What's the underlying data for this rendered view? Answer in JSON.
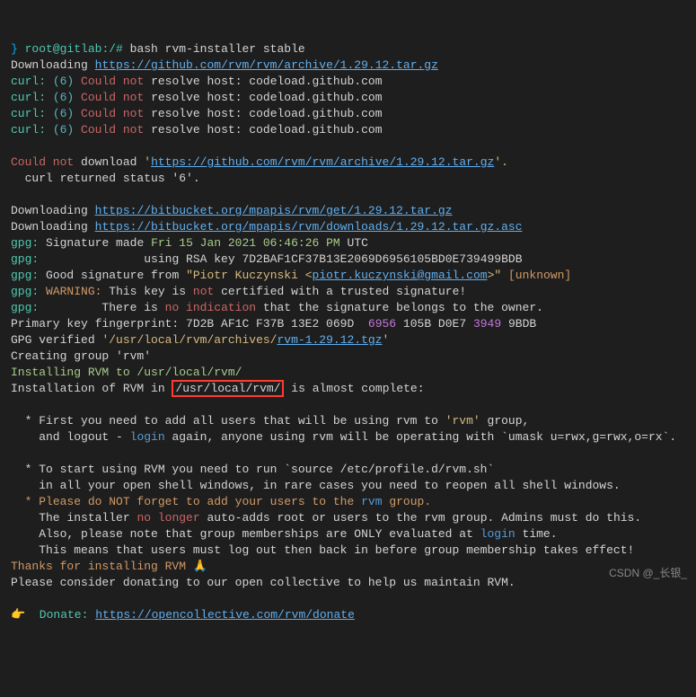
{
  "prompt": {
    "sym": "}",
    "userhost": "root@gitlab:/#",
    "cmd": "bash rvm-installer stable"
  },
  "dl1": {
    "label": "Downloading",
    "url": "https://github.com/rvm/rvm/archive/1.29.12.tar.gz"
  },
  "curlLines": [
    {
      "a": "curl:",
      "b": "(6)",
      "c": "Could not",
      "d": "resolve host: codeload.github.com"
    },
    {
      "a": "curl:",
      "b": "(6)",
      "c": "Could not",
      "d": "resolve host: codeload.github.com"
    },
    {
      "a": "curl:",
      "b": "(6)",
      "c": "Could not",
      "d": "resolve host: codeload.github.com"
    },
    {
      "a": "curl:",
      "b": "(6)",
      "c": "Could not",
      "d": "resolve host: codeload.github.com"
    }
  ],
  "err": {
    "could": "Could not",
    "downloadW": "download",
    "q1": "'",
    "url": "https://github.com/rvm/rvm/archive/1.29.12.tar.gz",
    "q2": "'.",
    "ret": "  curl returned status '6'."
  },
  "dl2": {
    "label": "Downloading",
    "url": "https://bitbucket.org/mpapis/rvm/get/1.29.12.tar.gz"
  },
  "dl3": {
    "label": "Downloading",
    "url": "https://bitbucket.org/mpapis/rvm/downloads/1.29.12.tar.gz.asc"
  },
  "gpg": {
    "sig1a": "gpg:",
    "sig1b": "Signature made",
    "sig1c": "Fri 15 Jan 2021 06:46:26 PM",
    "sig1d": "UTC",
    "sig2a": "gpg:",
    "sig2b": "               using RSA key 7D2BAF1CF37B13E2069D6956105BD0E739499BDB",
    "sig3a": "gpg:",
    "sig3b": "Good signature from",
    "sig3c": "\"Piotr Kuczynski <",
    "sig3email": "piotr.kuczynski@gmail.com",
    "sig3d": ">\"",
    "sig3e": "[unknown]",
    "warn1a": "gpg:",
    "warn1b": "WARNING:",
    "warn1c": "This key is",
    "warn1d": "not",
    "warn1e": "certified with a trusted signature!",
    "warn2a": "gpg:",
    "warn2b": "         There is",
    "warn2c": "no indication",
    "warn2d": "that the signature belongs to the owner.",
    "fp1": "Primary key fingerprint: 7D2B AF1C F37B 13E2 069D ",
    "fp2": "6956",
    "fp3": "105B D0E7",
    "fp4": "3949",
    "fp5": "9BDB",
    "ver1": "GPG verified",
    "ver2": "'/usr/local/rvm/archives/",
    "ver3": "rvm-1.29.12.tgz",
    "ver4": "'"
  },
  "creating": "Creating group 'rvm'",
  "installing": "Installing RVM to /usr/local/rvm/",
  "instOf": "Installation of RVM in",
  "instPath": "/usr/local/rvm/",
  "instRest": "is almost complete:",
  "bullet1a": "  * First you need to add all users that will be using rvm to",
  "bullet1b": "'rvm'",
  "bullet1c": "group,",
  "bullet1d": "    and logout -",
  "bullet1e": "login",
  "bullet1f": "again, anyone using rvm will be operating with `umask u=rwx,g=rwx,o=rx`.",
  "bullet2a": "  * To start using RVM you need to run `source /etc/profile.d/rvm.sh`",
  "bullet2b": "    in all your open shell windows, in rare cases you need to reopen all shell windows.",
  "bullet3a": "  *",
  "bullet3b": "Please do NOT forget to add your users to the",
  "bullet3c": "rvm",
  "bullet3d": "group.",
  "bullet3e": "    The installer",
  "bullet3f": "no longer",
  "bullet3g": "auto-adds root or users to the rvm group. Admins must do this.",
  "bullet3h": "    Also, please note that group memberships are ONLY evaluated at",
  "bullet3i": "login",
  "bullet3j": "time.",
  "bullet3k": "    This means that users must log out then back in before group membership takes effect!",
  "thanks": "Thanks for installing RVM 🙏",
  "consider": "Please consider donating to our open collective to help us maintain RVM.",
  "donateIcon": "👉",
  "donateLabel": "Donate:",
  "donateUrl": "https://opencollective.com/rvm/donate",
  "watermark": "CSDN @_长银_"
}
